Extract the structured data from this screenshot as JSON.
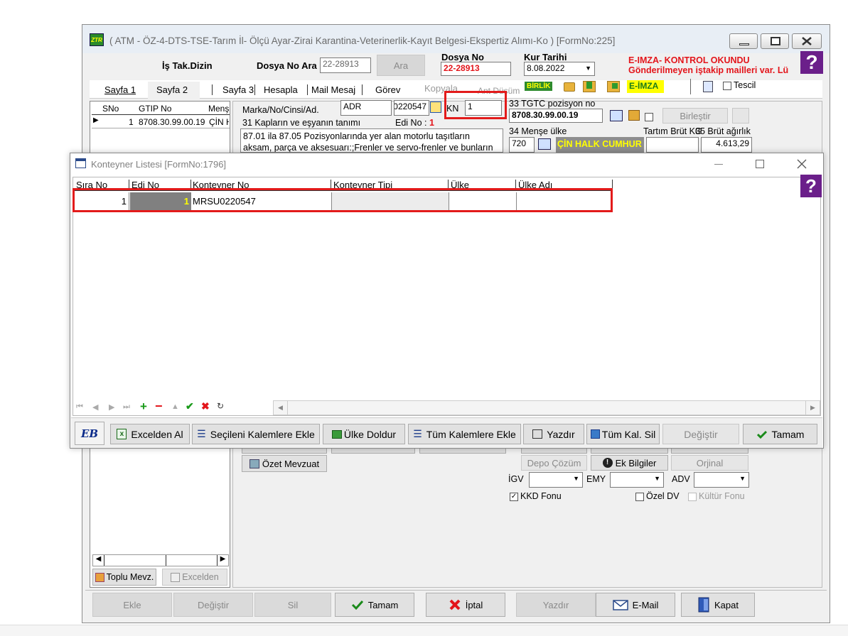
{
  "main_window": {
    "title": "( ATM - ÖZ-4-DTS-TSE-Tarım İl- Ölçü Ayar-Zirai Karantina-Veterinerlik-Kayıt Belgesi-Ekspertiz Alımı-Ko ) [FormNo:225]",
    "logo_text": "ZTR",
    "is_tak_dizin": "İş Tak.Dizin",
    "dosya_no_ara_label": "Dosya No Ara",
    "dosya_no_ara_value": "22-28913",
    "ara_button": "Ara",
    "dosya_no_label": "Dosya No",
    "dosya_no_value": "22-28913",
    "kur_tarihi_label": "Kur Tarihi",
    "kur_tarihi_value": "8.08.2022",
    "eimza_line1": "E-IMZA- KONTROL OKUNDU",
    "eimza_line2": "Gönderilmeyen iştakip mailleri var. Lü",
    "tabs": [
      "Sayfa 1",
      "Sayfa 2",
      "Sayfa 3",
      "Hesapla",
      "Mail Mesaj",
      "Görev"
    ],
    "kopyala": "Kopyala",
    "ant_dusum": "Ant Düşüm",
    "birlik": "BİRLİK",
    "eimza_badge": "E-İMZA",
    "tescil": "Tescil",
    "grid": {
      "headers": [
        "SNo",
        "GTIP No",
        "Menş"
      ],
      "row": {
        "sno": "1",
        "gtip": "8708.30.99.00.19",
        "mens": "ÇİN H"
      }
    },
    "marka_label": "Marka/No/Cinsi/Ad.",
    "marka_value": "ADR",
    "marka_value2": "0220547",
    "kn_label": "KN",
    "kn_value": "1",
    "kaplar_label": "31 Kapların ve eşyanın tanımı",
    "edi_no_label": "Edi No :",
    "edi_no_value": "1",
    "description_line1": "87.01 ila 87.05 Pozisyonlarında yer alan motorlu taşıtların",
    "description_line2": "aksam, parça ve aksesuarı:;Frenler ve servo-frenler ve bunların",
    "tgtc_label": "33 TGTC pozisyon no",
    "tgtc_value": "8708.30.99.00.19",
    "birlestir": "Birleştir",
    "mense_label": "34 Menşe ülke",
    "mense_code": "720",
    "mense_name": "ÇİN HALK CUMHUR",
    "tartim_label": "Tartım Brüt KG",
    "brut_label": "35 Brüt ağırlık",
    "brut_value": "4.613,29",
    "ozet_mevzuat": "Özet Mevzuat",
    "depo_cozum": "Depo Çözüm",
    "ek_bilgiler": "Ek Bilgiler",
    "orjinal": "Orjinal",
    "igv_label": "İGV",
    "emy_label": "EMY",
    "adv_label": "ADV",
    "kkd_fonu": "KKD Fonu",
    "ozel_dv": "Özel DV",
    "kultur_fonu": "Kültür Fonu",
    "toplu_mevz": "Toplu Mevz.",
    "excelden": "Excelden",
    "bottom_buttons": {
      "ekle": "Ekle",
      "degistir": "Değiştir",
      "sil": "Sil",
      "tamam": "Tamam",
      "iptal": "İptal",
      "yazdir": "Yazdır",
      "email": "E-Mail",
      "kapat": "Kapat"
    }
  },
  "dialog": {
    "title": "Konteyner Listesi [FormNo:1796]",
    "columns": [
      "Sıra No",
      "Edi No",
      "Konteyner No",
      "Konteyner Tipi",
      "Ülke",
      "Ülke Adı"
    ],
    "rows": [
      {
        "sira_no": "1",
        "edi_no": "1",
        "konteyner_no": "MRSU0220547",
        "konteyner_tipi": "",
        "ulke": "",
        "ulke_adi": ""
      }
    ],
    "logo_text": "EB",
    "buttons": {
      "excelden_al": "Excelden Al",
      "secileni_kalemlere_ekle": "Seçileni Kalemlere Ekle",
      "ulke_doldur": "Ülke Doldur",
      "tum_kalemlere_ekle": "Tüm Kalemlere Ekle",
      "yazdir": "Yazdır",
      "tum_kal_sil": "Tüm Kal. Sil",
      "degistir": "Değiştir",
      "tamam": "Tamam"
    }
  },
  "colors": {
    "accent_red": "#e3151b",
    "highlight_yellow": "#ffff00",
    "birlik_green": "#2e8b2e",
    "dialog_background": "#ffffff",
    "window_background": "#f0f0f0"
  }
}
